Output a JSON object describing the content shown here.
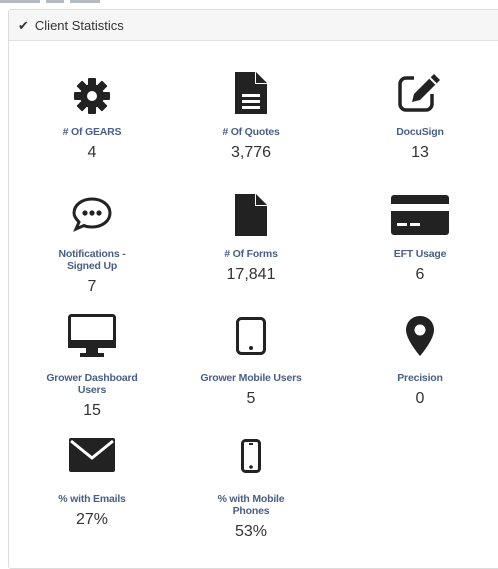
{
  "colors": {
    "icon": "#222222",
    "label": "#4a5f86",
    "value": "#333333"
  },
  "panel": {
    "title": "Client Statistics",
    "header_icon": "check-icon"
  },
  "stats": [
    {
      "label": "# Of GEARS",
      "value": "4",
      "icon": "gear-icon"
    },
    {
      "label": "# Of Quotes",
      "value": "3,776",
      "icon": "document-lines-icon"
    },
    {
      "label": "DocuSign",
      "value": "13",
      "icon": "edit-square-icon"
    },
    {
      "label": "Notifications - Signed Up",
      "value": "7",
      "icon": "chat-bubble-icon"
    },
    {
      "label": "# Of Forms",
      "value": "17,841",
      "icon": "document-icon"
    },
    {
      "label": "EFT Usage",
      "value": "6",
      "icon": "credit-card-icon"
    },
    {
      "label": "Grower Dashboard Users",
      "value": "15",
      "icon": "desktop-monitor-icon"
    },
    {
      "label": "Grower Mobile Users",
      "value": "5",
      "icon": "tablet-icon"
    },
    {
      "label": "Precision",
      "value": "0",
      "icon": "map-marker-icon"
    },
    {
      "label": "% with Emails",
      "value": "27%",
      "icon": "envelope-icon"
    },
    {
      "label": "% with Mobile Phones",
      "value": "53%",
      "icon": "mobile-phone-icon"
    }
  ]
}
